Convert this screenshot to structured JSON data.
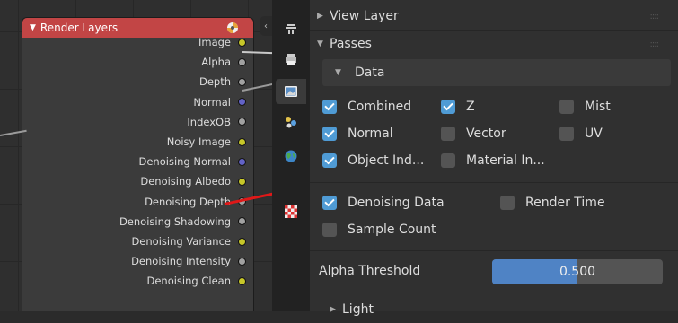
{
  "node": {
    "title": "Render Layers",
    "sockets": [
      {
        "label": "Image",
        "color": "#c7c729"
      },
      {
        "label": "Alpha",
        "color": "#a1a1a1"
      },
      {
        "label": "Depth",
        "color": "#a1a1a1"
      },
      {
        "label": "Normal",
        "color": "#6363c7"
      },
      {
        "label": "IndexOB",
        "color": "#a1a1a1"
      },
      {
        "label": "Noisy Image",
        "color": "#c7c729"
      },
      {
        "label": "Denoising Normal",
        "color": "#6363c7"
      },
      {
        "label": "Denoising Albedo",
        "color": "#c7c729"
      },
      {
        "label": "Denoising Depth",
        "color": "#a1a1a1"
      },
      {
        "label": "Denoising Shadowing",
        "color": "#a1a1a1"
      },
      {
        "label": "Denoising Variance",
        "color": "#c7c729"
      },
      {
        "label": "Denoising Intensity",
        "color": "#a1a1a1"
      },
      {
        "label": "Denoising Clean",
        "color": "#c7c729"
      }
    ]
  },
  "tabs": [
    {
      "name": "tool-tab",
      "active": false
    },
    {
      "name": "render-tab",
      "active": false
    },
    {
      "name": "output-tab",
      "active": true
    },
    {
      "name": "view-layer-tab",
      "active": false
    },
    {
      "name": "world-tab",
      "active": false
    },
    {
      "name": "texture-tab",
      "active": false
    }
  ],
  "panels": {
    "view_layer": "View Layer",
    "passes": "Passes",
    "data": "Data",
    "light": "Light"
  },
  "checkboxes": {
    "combined": {
      "label": "Combined",
      "checked": true
    },
    "z": {
      "label": "Z",
      "checked": true
    },
    "mist": {
      "label": "Mist",
      "checked": false
    },
    "normal": {
      "label": "Normal",
      "checked": true
    },
    "vector": {
      "label": "Vector",
      "checked": false
    },
    "uv": {
      "label": "UV",
      "checked": false
    },
    "object_index": {
      "label": "Object Ind...",
      "checked": true
    },
    "material_index": {
      "label": "Material In...",
      "checked": false
    },
    "denoising_data": {
      "label": "Denoising Data",
      "checked": true
    },
    "render_time": {
      "label": "Render Time",
      "checked": false
    },
    "sample_count": {
      "label": "Sample Count",
      "checked": false
    }
  },
  "alpha_threshold": {
    "label": "Alpha Threshold",
    "value": "0.500",
    "fraction": 0.5
  }
}
